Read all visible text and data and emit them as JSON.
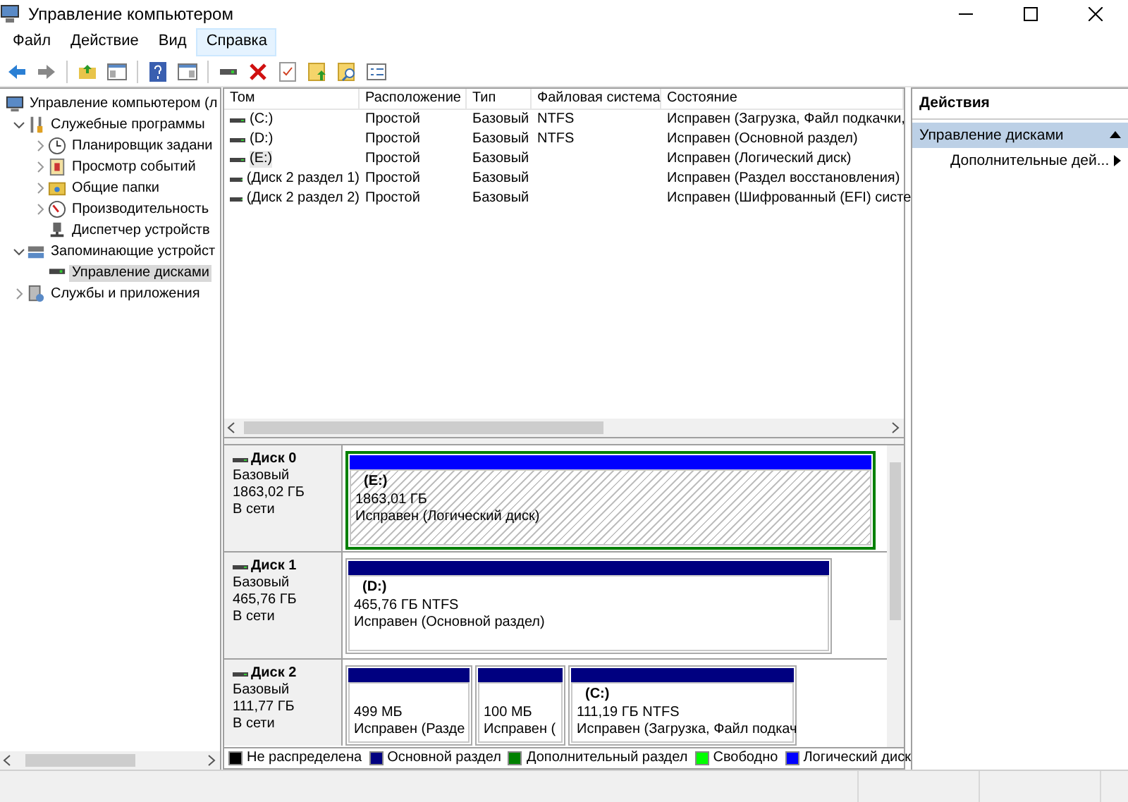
{
  "window": {
    "title": "Управление компьютером"
  },
  "menu": [
    {
      "label": "Файл",
      "selected": false
    },
    {
      "label": "Действие",
      "selected": false
    },
    {
      "label": "Вид",
      "selected": false
    },
    {
      "label": "Справка",
      "selected": true
    }
  ],
  "tree": [
    {
      "label": "Управление компьютером (л",
      "selected": false,
      "children": [
        {
          "label": "Служебные программы",
          "expanded": true,
          "selected": false,
          "children": [
            {
              "label": "Планировщик задани",
              "expanded": false,
              "selected": false
            },
            {
              "label": "Просмотр событий",
              "expanded": false,
              "selected": false
            },
            {
              "label": "Общие папки",
              "expanded": false,
              "selected": false
            },
            {
              "label": "Производительность",
              "expanded": false,
              "selected": false
            },
            {
              "label": "Диспетчер устройств",
              "selected": false
            }
          ]
        },
        {
          "label": "Запоминающие устройст",
          "expanded": true,
          "selected": false,
          "children": [
            {
              "label": "Управление дисками",
              "selected": true
            }
          ]
        },
        {
          "label": "Службы и приложения",
          "expanded": false,
          "selected": false
        }
      ]
    }
  ],
  "table": {
    "columns": [
      "Том",
      "Расположение",
      "Тип",
      "Файловая система",
      "Состояние"
    ],
    "rows": [
      {
        "cells": [
          "(C:)",
          "Простой",
          "Базовый",
          "NTFS",
          "Исправен (Загрузка, Файл подкачки,"
        ],
        "selected": false
      },
      {
        "cells": [
          "(D:)",
          "Простой",
          "Базовый",
          "NTFS",
          "Исправен (Основной раздел)"
        ],
        "selected": false
      },
      {
        "cells": [
          "(E:)",
          "Простой",
          "Базовый",
          "",
          "Исправен (Логический диск)"
        ],
        "selected": true
      },
      {
        "cells": [
          "(Диск 2 раздел 1)",
          "Простой",
          "Базовый",
          "",
          "Исправен (Раздел восстановления)"
        ],
        "selected": false
      },
      {
        "cells": [
          "(Диск 2 раздел 2)",
          "Простой",
          "Базовый",
          "",
          "Исправен (Шифрованный (EFI) систе"
        ],
        "selected": false
      }
    ]
  },
  "disks": [
    {
      "name": "Диск 0",
      "type": "Базовый",
      "size": "1863,02 ГБ",
      "status": "В сети",
      "partitions": [
        {
          "kind": "logical",
          "label": "(E:)",
          "size": "1863,01 ГБ",
          "status": "Исправен (Логический диск)",
          "selected": true
        }
      ]
    },
    {
      "name": "Диск 1",
      "type": "Базовый",
      "size": "465,76 ГБ",
      "status": "В сети",
      "partitions": [
        {
          "kind": "primary",
          "label": "(D:)",
          "size": "465,76 ГБ NTFS",
          "status": "Исправен (Основной раздел)",
          "selected": false
        }
      ]
    },
    {
      "name": "Диск 2",
      "type": "Базовый",
      "size": "111,77 ГБ",
      "status": "В сети",
      "partitions": [
        {
          "kind": "primary",
          "size": "499 МБ",
          "status": "Исправен (Разде",
          "selected": false
        },
        {
          "kind": "primary",
          "size": "100 МБ",
          "status": "Исправен (",
          "selected": false
        },
        {
          "kind": "primary",
          "label": "(C:)",
          "size": "111,19 ГБ NTFS",
          "status": "Исправен (Загрузка, Файл подкач",
          "selected": false
        }
      ]
    }
  ],
  "legend": [
    {
      "label": "Не распределена",
      "color": "#000000"
    },
    {
      "label": "Основной раздел",
      "color": "#000080"
    },
    {
      "label": "Дополнительный раздел",
      "color": "#008000"
    },
    {
      "label": "Свободно",
      "color": "#00ff00"
    },
    {
      "label": "Логический диск",
      "color": "#0000ff"
    }
  ],
  "actions": {
    "header": "Действия",
    "section": {
      "label": "Управление дисками",
      "expanded": true
    },
    "items": [
      "Дополнительные дей..."
    ]
  }
}
